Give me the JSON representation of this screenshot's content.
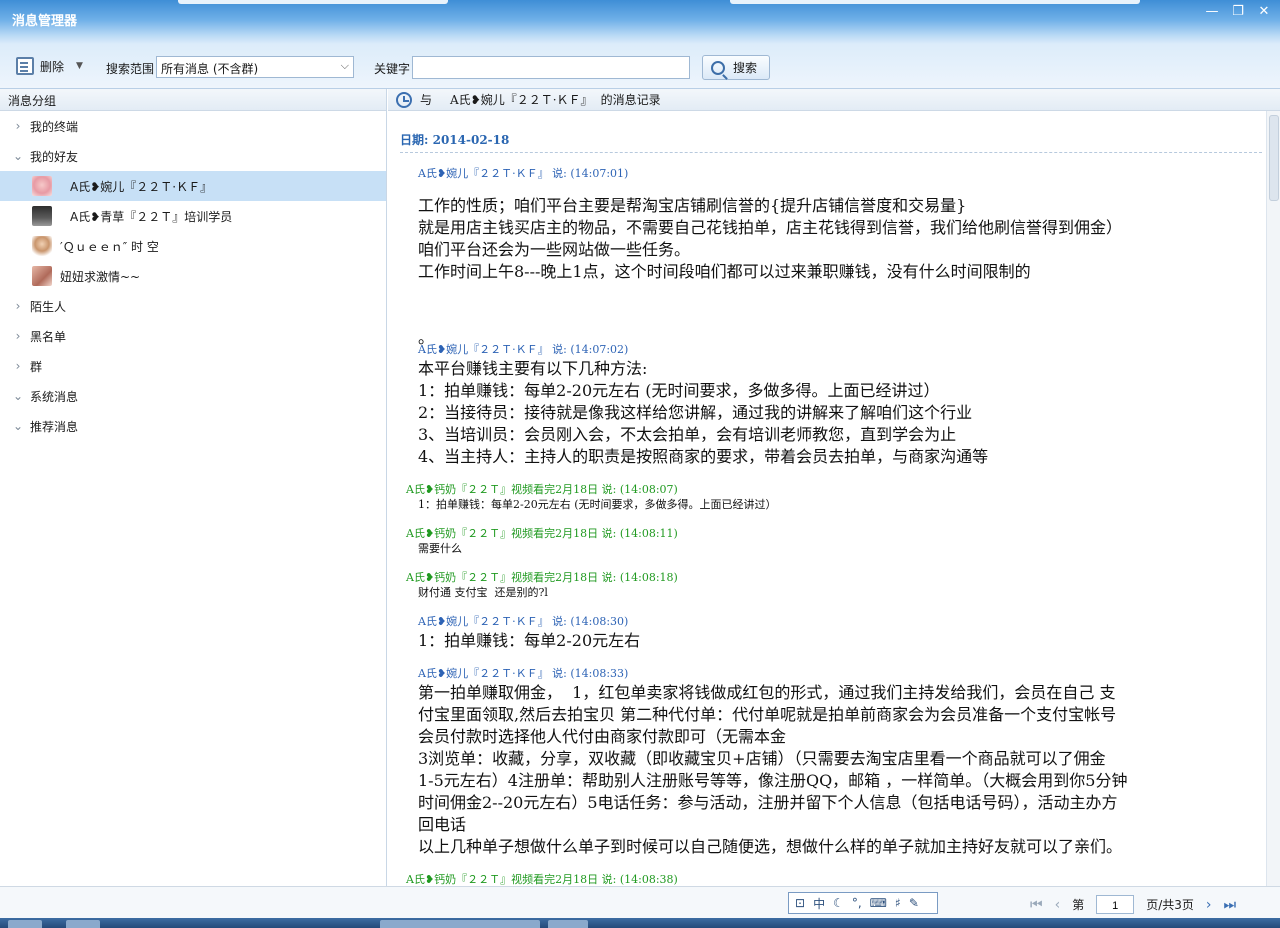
{
  "window": {
    "title": "消息管理器",
    "controls": [
      "—",
      "❐",
      "✕"
    ]
  },
  "toolbar": {
    "delete_label": "删除",
    "scope_label": "搜索范围",
    "scope_value": "所有消息 (不含群)",
    "keyword_label": "关键字",
    "keyword_value": "",
    "search_label": "搜索"
  },
  "sidebar": {
    "header": "消息分组",
    "groups": [
      {
        "label": "我的终端",
        "expanded": false
      },
      {
        "label": "我的好友",
        "expanded": true
      }
    ],
    "friends": [
      {
        "label": "A氏❥婉儿『２２Ｔ·ＫＦ』",
        "selected": true
      },
      {
        "label": "A氏❥青草『２２Ｔ』培训学员",
        "selected": false
      },
      {
        "label": "′Ｑｕｅｅｎ″ 时  空",
        "selected": false
      },
      {
        "label": "妞妞求激情~~",
        "selected": false
      }
    ],
    "more_groups": [
      {
        "label": "陌生人",
        "expanded": false
      },
      {
        "label": "黑名单",
        "expanded": false
      },
      {
        "label": "群",
        "expanded": false
      },
      {
        "label": "系统消息",
        "expanded": true
      },
      {
        "label": "推荐消息",
        "expanded": true
      }
    ]
  },
  "conversation": {
    "header_prefix": "与",
    "contact": "A氏❥婉儿『２２Ｔ·ＫＦ』",
    "header_suffix": "的消息记录",
    "date_label": "日期:  2014-02-18",
    "messages": [
      {
        "head": "A氏❥婉儿『２２Ｔ·ＫＦ』 说: (14:07:01)",
        "body": "工作的性质；咱们平台主要是帮淘宝店铺刷信誉的{提升店铺信誉度和交易量}\n就是用店主钱买店主的物品，不需要自己花钱拍单，店主花钱得到信誉，我们给他刷信誉得到佣金）\n咱们平台还会为一些网站做一些任务。\n工作时间上午8---晚上1点，这个时间段咱们都可以过来兼职赚钱，没有什么时间限制的\n\n\n。"
      },
      {
        "head": "A氏❥婉儿『２２Ｔ·ＫＦ』 说: (14:07:02)",
        "body": "本平台赚钱主要有以下几种方法:\n1：拍单赚钱：每单2-20元左右 (无时间要求，多做多得。上面已经讲过）\n2：当接待员：接待就是像我这样给您讲解，通过我的讲解来了解咱们这个行业\n3、当培训员：会员刚入会，不太会拍单，会有培训老师教您，直到学会为止\n4、当主持人：主持人的职责是按照商家的要求，带着会员去拍单，与商家沟通等"
      },
      {
        "head": "A氏❥钙奶『２２Ｔ』视频看完2月18日 说: (14:08:07)",
        "body": "1：拍单赚钱：每单2-20元左右 (无时间要求，多做多得。上面已经讲过）"
      },
      {
        "head": "A氏❥钙奶『２２Ｔ』视频看完2月18日 说: (14:08:11)",
        "body": "需要什么"
      },
      {
        "head": "A氏❥钙奶『２２Ｔ』视频看完2月18日 说: (14:08:18)",
        "body": "财付通 支付宝  还是别的?l"
      },
      {
        "head": "A氏❥婉儿『２２Ｔ·ＫＦ』 说: (14:08:30)",
        "body": "1：拍单赚钱：每单2-20元左右"
      },
      {
        "head": "A氏❥婉儿『２２Ｔ·ＫＦ』 说: (14:08:33)",
        "body": "第一拍单赚取佣金，  1，红包单卖家将钱做成红包的形式，通过我们主持发给我们，会员在自己 支\n付宝里面领取,然后去拍宝贝 第二种代付单：代付单呢就是拍单前商家会为会员准备一个支付宝帐号\n会员付款时选择他人代付由商家付款即可（无需本金\n3浏览单：收藏，分享，双收藏（即收藏宝贝+店铺）（只需要去淘宝店里看一个商品就可以了佣金\n1-5元左右）4注册单：帮助别人注册账号等等，像注册QQ，邮箱 ，一样简单。（大概会用到你5分钟\n时间佣金2--20元左右）5电话任务：参与活动，注册并留下个人信息（包括电话号码），活动主办方\n回电话\n以上几种单子想做什么单子到时候可以自己随便选，想做什么样的单子就加主持好友就可以了亲们。"
      },
      {
        "head": "A氏❥钙奶『２２Ｔ』视频看完2月18日 说: (14:08:38)",
        "body": ""
      }
    ]
  },
  "ime": {
    "label": "中"
  },
  "pager": {
    "prefix": "第",
    "current": "1",
    "suffix": "页/共3页"
  },
  "colors": {
    "accent": "#2d63b5",
    "green_sender": "#219a21",
    "selected_row": "#c7e0f6"
  }
}
